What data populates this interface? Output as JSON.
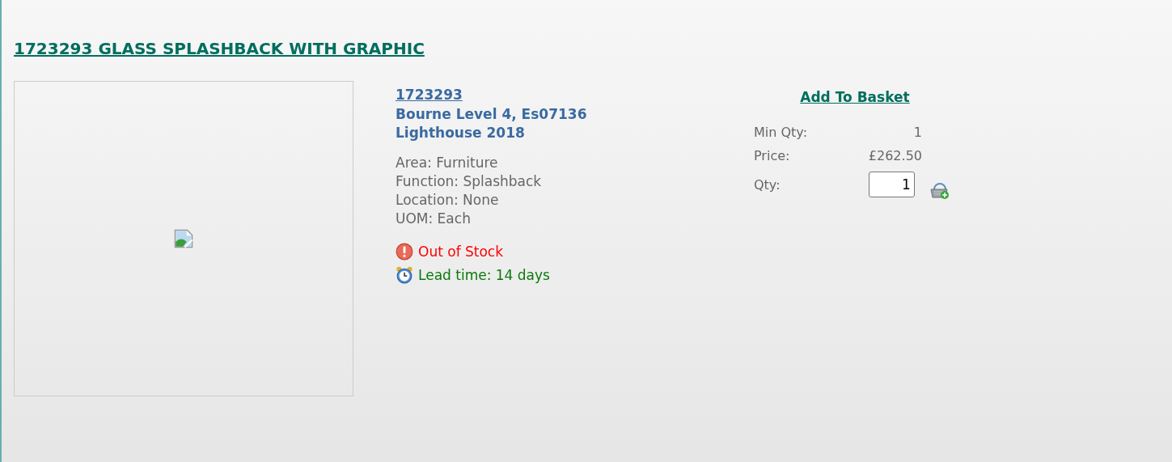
{
  "title": "1723293 GLASS SPLASHBACK WITH GRAPHIC",
  "product": {
    "code": "1723293",
    "lines": [
      "Bourne Level 4, Es07136",
      "Lighthouse 2018"
    ],
    "attributes": [
      "Area: Furniture",
      "Function: Splashback",
      "Location: None",
      "UOM: Each"
    ],
    "statuses": [
      {
        "kind": "out_of_stock",
        "text": "Out of Stock"
      },
      {
        "kind": "lead_time",
        "text": "Lead time: 14 days"
      }
    ]
  },
  "basket": {
    "link": "Add To Basket",
    "rows": [
      {
        "label": "Min Qty:",
        "value": "1"
      },
      {
        "label": "Price:",
        "value": "£262.50"
      }
    ],
    "qty": {
      "label": "Qty:",
      "value": "1"
    }
  }
}
